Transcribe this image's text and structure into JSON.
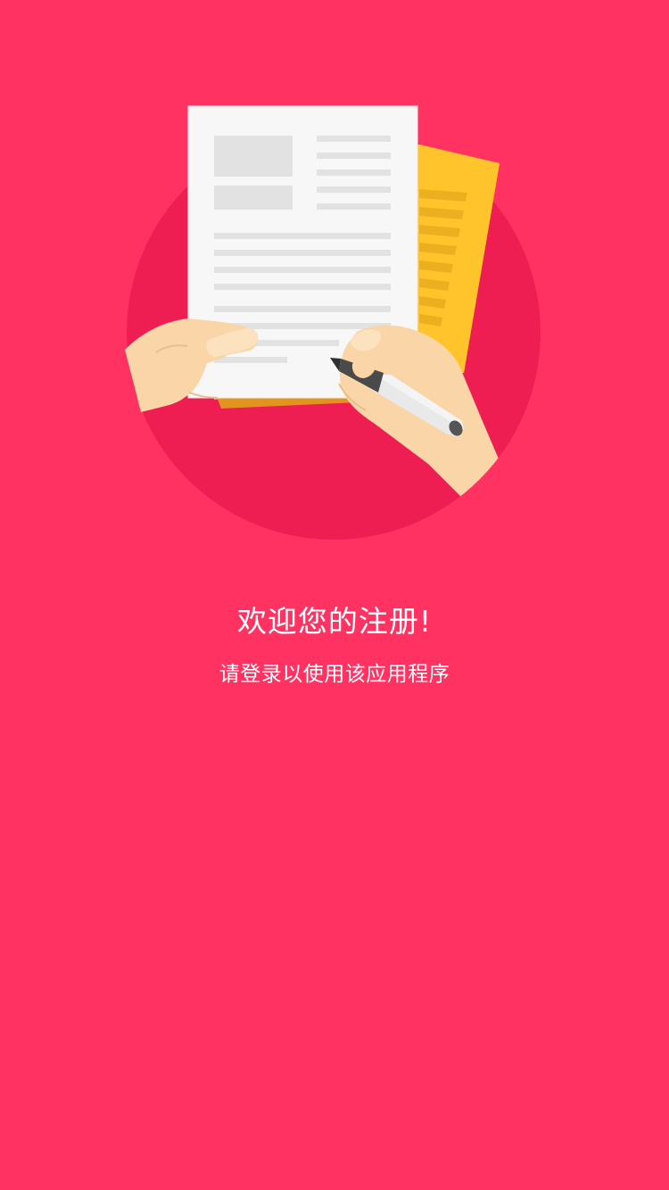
{
  "welcome": {
    "title": "欢迎您的注册!",
    "subtitle": "请登录以使用该应用程序"
  },
  "theme": {
    "background": "#FF3262",
    "circle": "#EE1E52",
    "paper_back": "#FFC42B",
    "paper_front": "#F7F7F7",
    "skin": "#F9D5A7"
  },
  "illustration": {
    "icon": "document-signing-illustration"
  }
}
